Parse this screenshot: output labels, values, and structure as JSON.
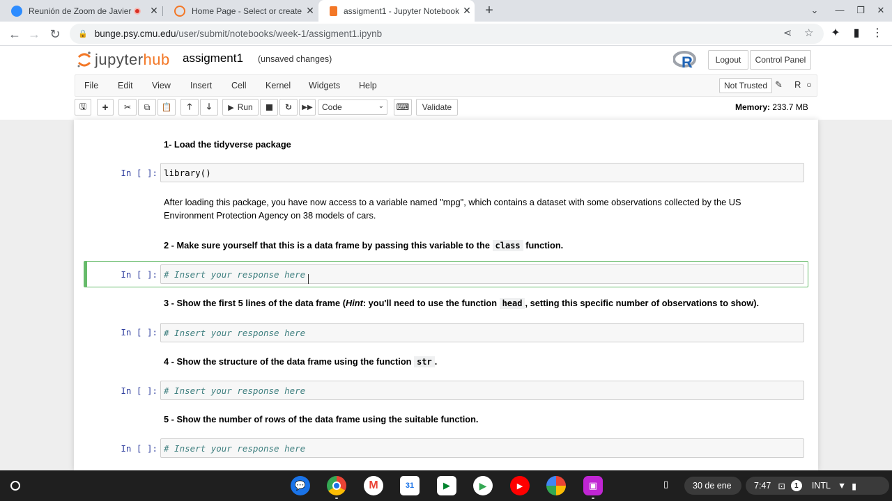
{
  "browser": {
    "tabs": [
      {
        "title": "Reunión de Zoom de Javier",
        "favicon_color": "#2d8cff"
      },
      {
        "title": "Home Page - Select or create a n",
        "favicon_color": "#f37726"
      },
      {
        "title": "assigment1 - Jupyter Notebook",
        "favicon_color": "#f37726"
      }
    ],
    "new_tab_symbol": "+",
    "url_host": "bunge.psy.cmu.edu",
    "url_path": "/user/submit/notebooks/week-1/assigment1.ipynb"
  },
  "jupyter": {
    "logo_text_a": "jupyter",
    "logo_text_b": "hub",
    "notebook_name": "assigment1",
    "save_status": "(unsaved changes)",
    "logout_label": "Logout",
    "control_panel_label": "Control Panel",
    "menu": [
      "File",
      "Edit",
      "View",
      "Insert",
      "Cell",
      "Kernel",
      "Widgets",
      "Help"
    ],
    "not_trusted_label": "Not Trusted",
    "kernel_name": "R",
    "run_label": "Run",
    "cell_type": "Code",
    "validate_label": "Validate",
    "memory_label": "Memory:",
    "memory_value": "233.7 MB"
  },
  "cells": {
    "md1": "1- Load the tidyverse package",
    "prompt": "In [ ]:",
    "code1": "library()",
    "md2": "After loading this package, you have now access to a variable named \"mpg\", which contains a dataset with some observations collected by the US Environment Protection Agency on 38 models of cars.",
    "md3_a": "2 - Make sure yourself that this is a data frame by passing this variable to the",
    "md3_code": "class",
    "md3_b": "function.",
    "code_placeholder": "# Insert your response here",
    "md4_a": "3 - Show the first 5 lines of the data frame (",
    "md4_hint": "Hint",
    "md4_b": ": you'll need to use the function",
    "md4_code": "head",
    "md4_c": ", setting this specific number of observations to show).",
    "md5_a": "4 - Show the structure of the data frame using the function",
    "md5_code": "str",
    "md5_b": ".",
    "md6": "5 - Show the number of rows of the data frame using the suitable function."
  },
  "taskbar": {
    "date": "30 de ene",
    "time": "7:47",
    "notification_count": "1",
    "keyboard_layout": "INTL"
  },
  "colors": {
    "jupyter_orange": "#f37726",
    "selected_cell_border": "#66bb6a",
    "prompt_blue": "#303f9f",
    "comment_teal": "#408080"
  }
}
